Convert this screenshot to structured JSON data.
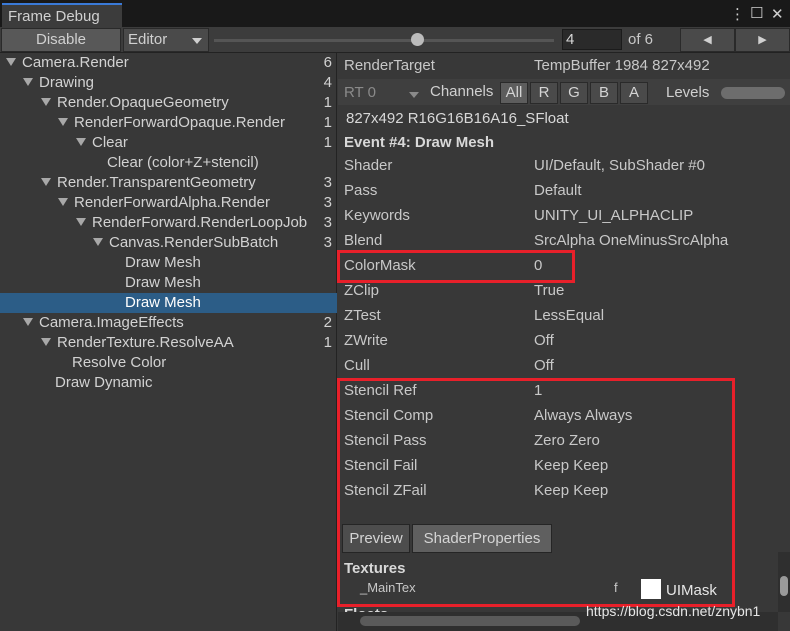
{
  "window": {
    "tab_title": "Frame Debug",
    "menu_icon": "⋮",
    "maximize_icon": "☐",
    "close_icon": "✕"
  },
  "toolbar": {
    "disable_label": "Disable",
    "target_label": "Editor",
    "frame_value": "4",
    "frame_of": "of 6",
    "prev_icon": "◀",
    "next_icon": "▶",
    "slider_fraction": 0.6
  },
  "tree": [
    {
      "label": "Camera.Render",
      "count": "6",
      "expanded": true
    },
    {
      "label": "Drawing",
      "count": "4",
      "expanded": true
    },
    {
      "label": "Render.OpaqueGeometry",
      "count": "1",
      "expanded": true
    },
    {
      "label": "RenderForwardOpaque.Render",
      "count": "1",
      "expanded": true
    },
    {
      "label": "Clear",
      "count": "1",
      "expanded": true
    },
    {
      "label": "Clear (color+Z+stencil)",
      "count": ""
    },
    {
      "label": "Render.TransparentGeometry",
      "count": "3",
      "expanded": true
    },
    {
      "label": "RenderForwardAlpha.Render",
      "count": "3",
      "expanded": true
    },
    {
      "label": "RenderForward.RenderLoopJob",
      "count": "3",
      "expanded": true
    },
    {
      "label": "Canvas.RenderSubBatch",
      "count": "3",
      "expanded": true
    },
    {
      "label": "Draw Mesh",
      "count": ""
    },
    {
      "label": "Draw Mesh",
      "count": ""
    },
    {
      "label": "Draw Mesh",
      "count": "",
      "selected": true
    },
    {
      "label": "Camera.ImageEffects",
      "count": "2",
      "expanded": true
    },
    {
      "label": "RenderTexture.ResolveAA",
      "count": "1",
      "expanded": true
    },
    {
      "label": "Resolve Color",
      "count": ""
    },
    {
      "label": "Draw Dynamic",
      "count": ""
    }
  ],
  "details": {
    "render_target_label": "RenderTarget",
    "render_target_value": "TempBuffer 1984 827x492",
    "rt_select": "RT 0",
    "channels_label": "Channels",
    "channels": [
      "All",
      "R",
      "G",
      "B",
      "A"
    ],
    "levels_label": "Levels",
    "format": "827x492 R16G16B16A16_SFloat",
    "event_title": "Event #4: Draw Mesh",
    "properties": [
      {
        "name": "Shader",
        "value": "UI/Default, SubShader #0"
      },
      {
        "name": "Pass",
        "value": "Default"
      },
      {
        "name": "Keywords",
        "value": "UNITY_UI_ALPHACLIP"
      },
      {
        "name": "Blend",
        "value": "SrcAlpha OneMinusSrcAlpha"
      },
      {
        "name": "ColorMask",
        "value": "0"
      },
      {
        "name": "ZClip",
        "value": "True"
      },
      {
        "name": "ZTest",
        "value": "LessEqual"
      },
      {
        "name": "ZWrite",
        "value": "Off"
      },
      {
        "name": "Cull",
        "value": "Off"
      },
      {
        "name": "Stencil Ref",
        "value": "1"
      },
      {
        "name": "Stencil Comp",
        "value": "Always Always"
      },
      {
        "name": "Stencil Pass",
        "value": "Zero Zero"
      },
      {
        "name": "Stencil Fail",
        "value": "Keep Keep"
      },
      {
        "name": "Stencil ZFail",
        "value": "Keep Keep"
      }
    ],
    "tabs": [
      "Preview",
      "ShaderProperties"
    ],
    "textures_header": "Textures",
    "texture_name": "_MainTex",
    "texture_stage": "f",
    "texture_value": "UIMask",
    "next_header": "Floats",
    "highlight_color": "#e8202a"
  },
  "watermark": "https://blog.csdn.net/znybn1"
}
